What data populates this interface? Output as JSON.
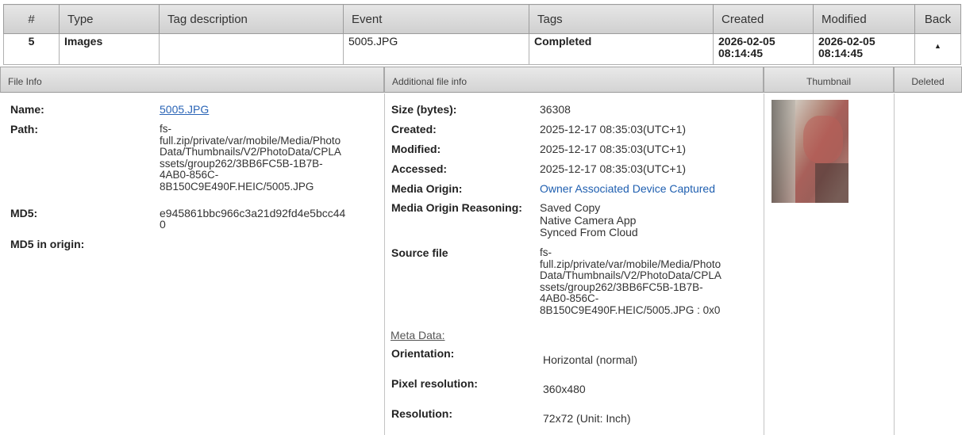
{
  "header": {
    "cols": [
      "#",
      "Type",
      "Tag description",
      "Event",
      "Tags",
      "Created",
      "Modified",
      "Back"
    ]
  },
  "row": {
    "num": "5",
    "type": "Images",
    "tag_description": "",
    "event": "5005.JPG",
    "tags": "Completed",
    "created": "2026-02-05 08:14:45",
    "modified": "2026-02-05 08:14:45",
    "back_arrow": "▲"
  },
  "sections": {
    "file_info": "File Info",
    "additional": "Additional file info",
    "thumbnail": "Thumbnail",
    "deleted": "Deleted"
  },
  "file_info": {
    "name_label": "Name:",
    "name_value": "5005.JPG",
    "path_label": "Path:",
    "path_value": "fs-\nfull.zip/private/var/mobile/Media/Photo\nData/Thumbnails/V2/PhotoData/CPLA\nssets/group262/3BB6FC5B-1B7B-\n4AB0-856C-\n8B150C9E490F.HEIC/5005.JPG",
    "md5_label": "MD5:",
    "md5_value": "e945861bbc966c3a21d92fd4e5bcc44\n0",
    "md5_origin_label": "MD5 in origin:"
  },
  "additional": {
    "size_label": "Size (bytes):",
    "size_value": "36308",
    "created_label": "Created:",
    "created_value": "2025-12-17 08:35:03(UTC+1)",
    "modified_label": "Modified:",
    "modified_value": "2025-12-17 08:35:03(UTC+1)",
    "accessed_label": "Accessed:",
    "accessed_value": "2025-12-17 08:35:03(UTC+1)",
    "media_origin_label": "Media Origin:",
    "media_origin_value": "Owner Associated Device Captured",
    "reasoning_label": "Media Origin Reasoning:",
    "reasoning_value": "Saved Copy\nNative Camera App\nSynced From Cloud",
    "source_label": "Source file",
    "source_value": "fs-\nfull.zip/private/var/mobile/Media/Photo\nData/Thumbnails/V2/PhotoData/CPLA\nssets/group262/3BB6FC5B-1B7B-\n4AB0-856C-\n8B150C9E490F.HEIC/5005.JPG : 0x0",
    "meta_title": "Meta Data:",
    "orientation_label": "Orientation:",
    "orientation_value": "Horizontal (normal)",
    "pixel_res_label": "Pixel resolution:",
    "pixel_res_value": "360x480",
    "resolution_label": "Resolution:",
    "resolution_value": "72x72 (Unit: Inch)"
  }
}
